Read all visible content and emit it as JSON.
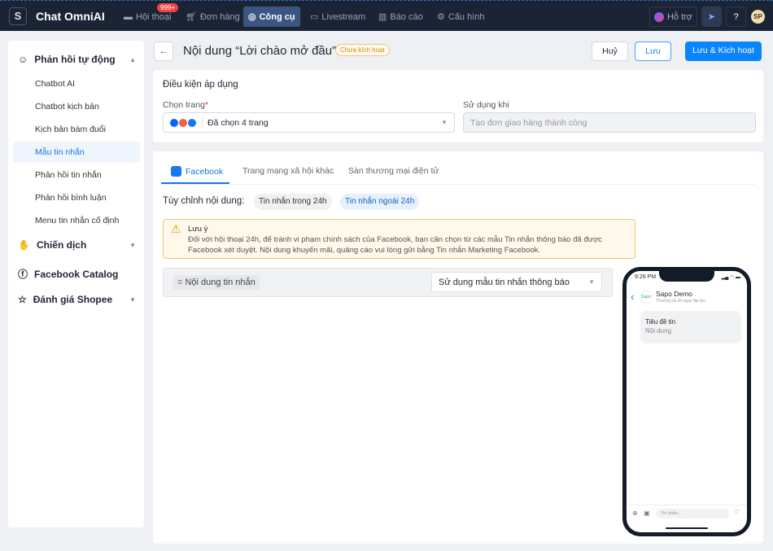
{
  "topbar": {
    "logo": "S",
    "brand": "Chat OmniAI",
    "nav": [
      {
        "label": "Hội thoại",
        "icon": "chat-icon",
        "badge": "999+"
      },
      {
        "label": "Đơn hàng",
        "icon": "cart-icon"
      },
      {
        "label": "Công cụ",
        "icon": "tools-icon",
        "active": true
      },
      {
        "label": "Livestream",
        "icon": "video-icon"
      },
      {
        "label": "Báo cáo",
        "icon": "bar-chart-icon"
      },
      {
        "label": "Cấu hình",
        "icon": "gear-icon"
      }
    ],
    "support": "Hỗ trợ",
    "avatar": "SP"
  },
  "sidebar": {
    "groups": [
      {
        "label": "Phản hồi tự động",
        "icon": "bot-icon",
        "items": [
          "Chatbot AI",
          "Chatbot kịch bản",
          "Kịch bản bám đuổi",
          "Mẫu tin nhắn",
          "Phản hồi tin nhắn",
          "Phản hồi bình luận",
          "Menu tin nhắn cố định"
        ],
        "active": "Mẫu tin nhắn"
      },
      {
        "label": "Chiến dịch",
        "icon": "megaphone-icon"
      },
      {
        "label": "Facebook Catalog",
        "icon": "catalog-icon"
      },
      {
        "label": "Đánh giá Shopee",
        "icon": "star-icon"
      }
    ]
  },
  "header": {
    "title": "Nội dung “Lời chào mở đầu”",
    "status": "Chưa kích hoạt",
    "cancel": "Huỷ",
    "save": "Lưu",
    "save_activate": "Lưu & Kích hoạt"
  },
  "conditions": {
    "title": "Điều kiện áp dụng",
    "page_label": "Chọn trang",
    "required": "*",
    "page_value": "Đã chọn 4 trang",
    "when_label": "Sử dụng khi",
    "when_value": "Tạo đơn giao hàng thành công"
  },
  "tabs": [
    "Facebook",
    "Trang mạng xã hội khác",
    "Sàn thương mại điện tử"
  ],
  "customize": {
    "label": "Tùy chỉnh nội dung:",
    "chips": [
      "Tin nhắn trong 24h",
      "Tin nhắn ngoài 24h"
    ],
    "active": "Tin nhắn ngoài 24h"
  },
  "warning": {
    "title": "Lưu ý",
    "text": "Đối với hội thoại 24h, để tránh vi phạm chính sách của Facebook, bạn cần chọn từ các mẫu Tin nhắn thông báo đã được Facebook xét duyệt. Nội dung khuyến mãi, quảng cáo vui lòng gửi bằng Tin nhắn Marketing Facebook."
  },
  "content": {
    "label": "Nội dung tin nhắn",
    "select": "Sử dụng mẫu tin nhắn thông báo"
  },
  "preview": {
    "time": "9:26 PM",
    "name": "Sapo Demo",
    "subtitle": "Thường trả lời ngay lập tức",
    "logo": "Sapo",
    "msg_title": "Tiêu đề tin",
    "msg_body": "Nội dung",
    "input_placeholder": "Tin nhắn..."
  },
  "colors": {
    "primary": "#0a84ff",
    "topbar": "#1b2435",
    "warning": "#f3c56b"
  }
}
